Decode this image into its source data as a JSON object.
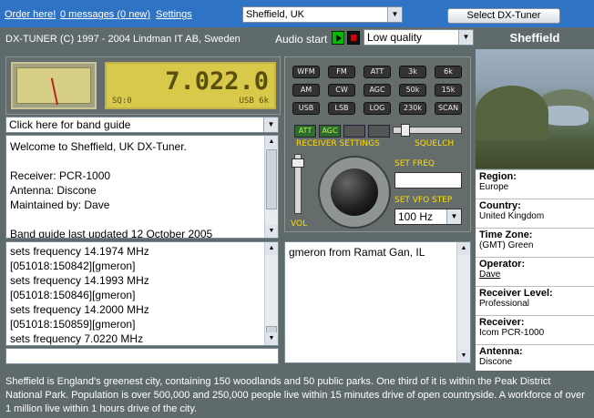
{
  "header": {
    "links": [
      "Order here!",
      "0 messages (0 new)",
      "Settings"
    ],
    "station": "Sheffield, UK",
    "select_button": "Select DX-Tuner"
  },
  "copyright": "DX-TUNER (C) 1997 - 2004 Lindman IT AB, Sweden",
  "audio": {
    "label": "Audio start",
    "quality": "Low quality"
  },
  "city": "Sheffield",
  "radio": {
    "frequency": "7.022.0",
    "squelch_text": "SQ:0",
    "mode_text": "USB  6k"
  },
  "band_guide": "Click here for band guide",
  "welcome": "Welcome to Sheffield, UK DX-Tuner.\n\nReceiver: PCR-1000\nAntenna: Discone\nMaintained by: Dave\n\nBand guide last updated 12 October 2005",
  "log": [
    "sets frequency 14.1974 MHz",
    "[051018:150842][gmeron]",
    "sets frequency 14.1993 MHz",
    "[051018:150846][gmeron]",
    "sets frequency 14.2000 MHz",
    "[051018:150859][gmeron]",
    "sets frequency 7.0220 MHz"
  ],
  "controls": {
    "buttons": [
      "WFM",
      "FM",
      "ATT",
      "3k",
      "6k",
      "AM",
      "CW",
      "AGC",
      "50k",
      "15k",
      "USB",
      "LSB",
      "LOG",
      "230k",
      "SCAN"
    ],
    "indicators": [
      "ATT",
      "AGC"
    ],
    "receiver_settings": "RECEIVER SETTINGS",
    "squelch": "SQUELCH",
    "vol": "VOL",
    "set_freq": "SET FREQ",
    "set_vfo_step": "SET VFO STEP",
    "vfo_step_value": "100 Hz"
  },
  "chat": "gmeron from Ramat Gan, IL",
  "station_info": [
    {
      "label": "Region:",
      "value": "Europe"
    },
    {
      "label": "Country:",
      "value": "United Kingdom"
    },
    {
      "label": "Time Zone:",
      "value": "(GMT) Green"
    },
    {
      "label": "Operator:",
      "value": "Dave"
    },
    {
      "label": "Receiver Level:",
      "value": "Professional"
    },
    {
      "label": "Receiver:",
      "value": "Icom PCR-1000"
    },
    {
      "label": "Antenna:",
      "value": "Discone"
    }
  ],
  "footer": "Sheffield is England's greenest city, containing 150 woodlands and 50 public parks. One third of it is within the Peak District National Park. Population is over 500,000 and 250,000 people live within 15 minutes drive of open countryside. A workforce of over 1 million live within 1 hours drive of the city.",
  "colors": {
    "top_bar": "#2f73c4",
    "panel": "#5f6b6b",
    "display": "#d9c94b",
    "label_yellow": "#ffde00"
  }
}
